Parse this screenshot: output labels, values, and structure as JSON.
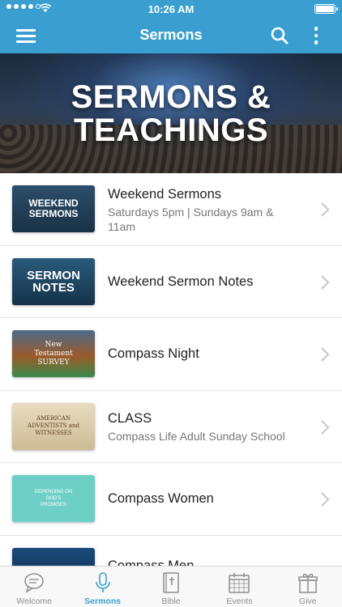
{
  "status_bar": {
    "time": "10:26 AM"
  },
  "header": {
    "title": "Sermons"
  },
  "hero": {
    "line1": "SERMONS &",
    "line2": "TEACHINGS"
  },
  "items": [
    {
      "title": "Weekend Sermons",
      "subtitle": "Saturdays 5pm | Sundays 9am & 11am",
      "thumb": "WEEKEND SERMONS"
    },
    {
      "title": "Weekend Sermon Notes",
      "thumb": "SERMON NOTES"
    },
    {
      "title": "Compass Night",
      "thumb": "New Testament SURVEY"
    },
    {
      "title": "CLASS",
      "subtitle": "Compass Life Adult Sunday School",
      "thumb": "AMERICAN ADVENTISTS and WITNESSES"
    },
    {
      "title": "Compass Women",
      "thumb": "DEPENDING ON GOD'S PROMISES"
    },
    {
      "title": "Compass Men"
    }
  ],
  "tabs": [
    {
      "label": "Welcome",
      "icon": "chat-bubble-icon"
    },
    {
      "label": "Sermons",
      "icon": "microphone-icon",
      "active": true
    },
    {
      "label": "Bible",
      "icon": "bible-icon"
    },
    {
      "label": "Events",
      "icon": "calendar-icon"
    },
    {
      "label": "Give",
      "icon": "gift-icon"
    }
  ],
  "colors": {
    "accent": "#3a9fd0",
    "tab_inactive": "#8e8e93",
    "divider": "#e2e2e2"
  }
}
